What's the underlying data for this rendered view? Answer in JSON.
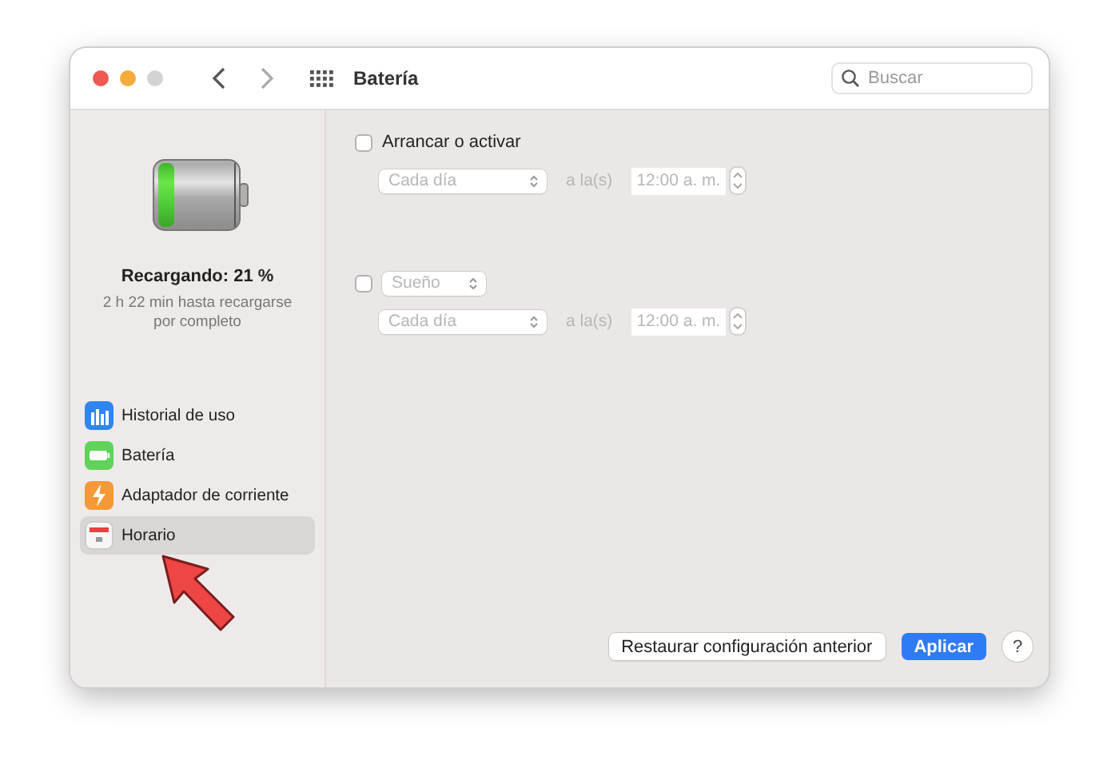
{
  "window": {
    "title": "Batería"
  },
  "search": {
    "placeholder": "Buscar"
  },
  "battery": {
    "level": 0.21,
    "status": "Recargando: 21 %",
    "detail": "2 h 22 min hasta recargarse por completo"
  },
  "sidebar": {
    "items": [
      {
        "label": "Historial de uso",
        "kind": "usage",
        "selected": false
      },
      {
        "label": "Batería",
        "kind": "battery",
        "selected": false
      },
      {
        "label": "Adaptador de corriente",
        "kind": "adapter",
        "selected": false
      },
      {
        "label": "Horario",
        "kind": "schedule",
        "selected": true
      }
    ]
  },
  "schedule": [
    {
      "kind": "label",
      "checked": false,
      "action": "Arrancar o activar",
      "frequency": "Cada día",
      "connector": "a la(s)",
      "time": "12:00 a. m."
    },
    {
      "kind": "popup",
      "checked": false,
      "action": "Sueño",
      "frequency": "Cada día",
      "connector": "a la(s)",
      "time": "12:00 a. m."
    }
  ],
  "buttons": [
    {
      "label": "Restaurar configuración anterior",
      "kind": "secondary"
    },
    {
      "label": "Aplicar",
      "kind": "primary"
    }
  ],
  "help": "?"
}
